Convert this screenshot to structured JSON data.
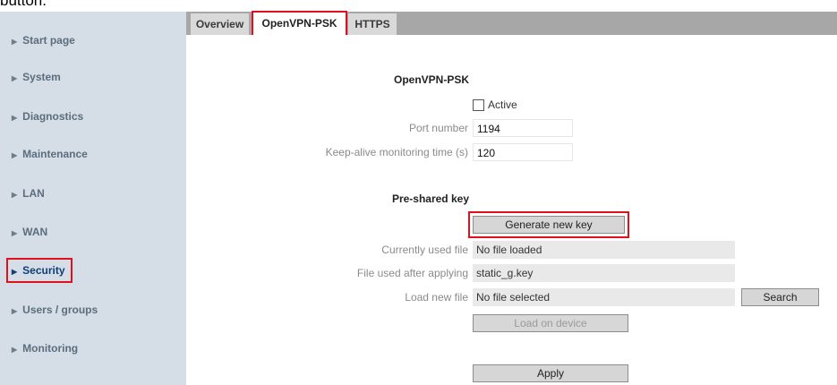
{
  "caption": "button.",
  "sidebar": {
    "items": [
      {
        "label": "Start page"
      },
      {
        "label": "System"
      },
      {
        "label": "Diagnostics"
      },
      {
        "label": "Maintenance"
      },
      {
        "label": "LAN"
      },
      {
        "label": "WAN"
      },
      {
        "label": "Security"
      },
      {
        "label": "Users / groups"
      },
      {
        "label": "Monitoring"
      }
    ],
    "active": "Security"
  },
  "tabs": [
    {
      "label": "Overview"
    },
    {
      "label": "OpenVPN-PSK"
    },
    {
      "label": "HTTPS"
    }
  ],
  "selected_tab": "OpenVPN-PSK",
  "openvpn": {
    "title": "OpenVPN-PSK",
    "active_label": "Active",
    "active_checked": false,
    "port_label": "Port number",
    "port_value": "1194",
    "keepalive_label": "Keep-alive monitoring time (s)",
    "keepalive_value": "120"
  },
  "psk": {
    "title": "Pre-shared key",
    "generate_label": "Generate new key",
    "current_file_label": "Currently used file",
    "current_file_value": "No file loaded",
    "after_apply_label": "File used after applying",
    "after_apply_value": "static_g.key",
    "load_new_label": "Load new file",
    "load_new_value": "No file selected",
    "search_label": "Search",
    "load_device_label": "Load on device"
  },
  "apply_label": "Apply",
  "colors": {
    "highlight": "#e0101f",
    "sidebar_bg": "#d5dde6",
    "tabbar_bg": "#a7a7a7"
  }
}
